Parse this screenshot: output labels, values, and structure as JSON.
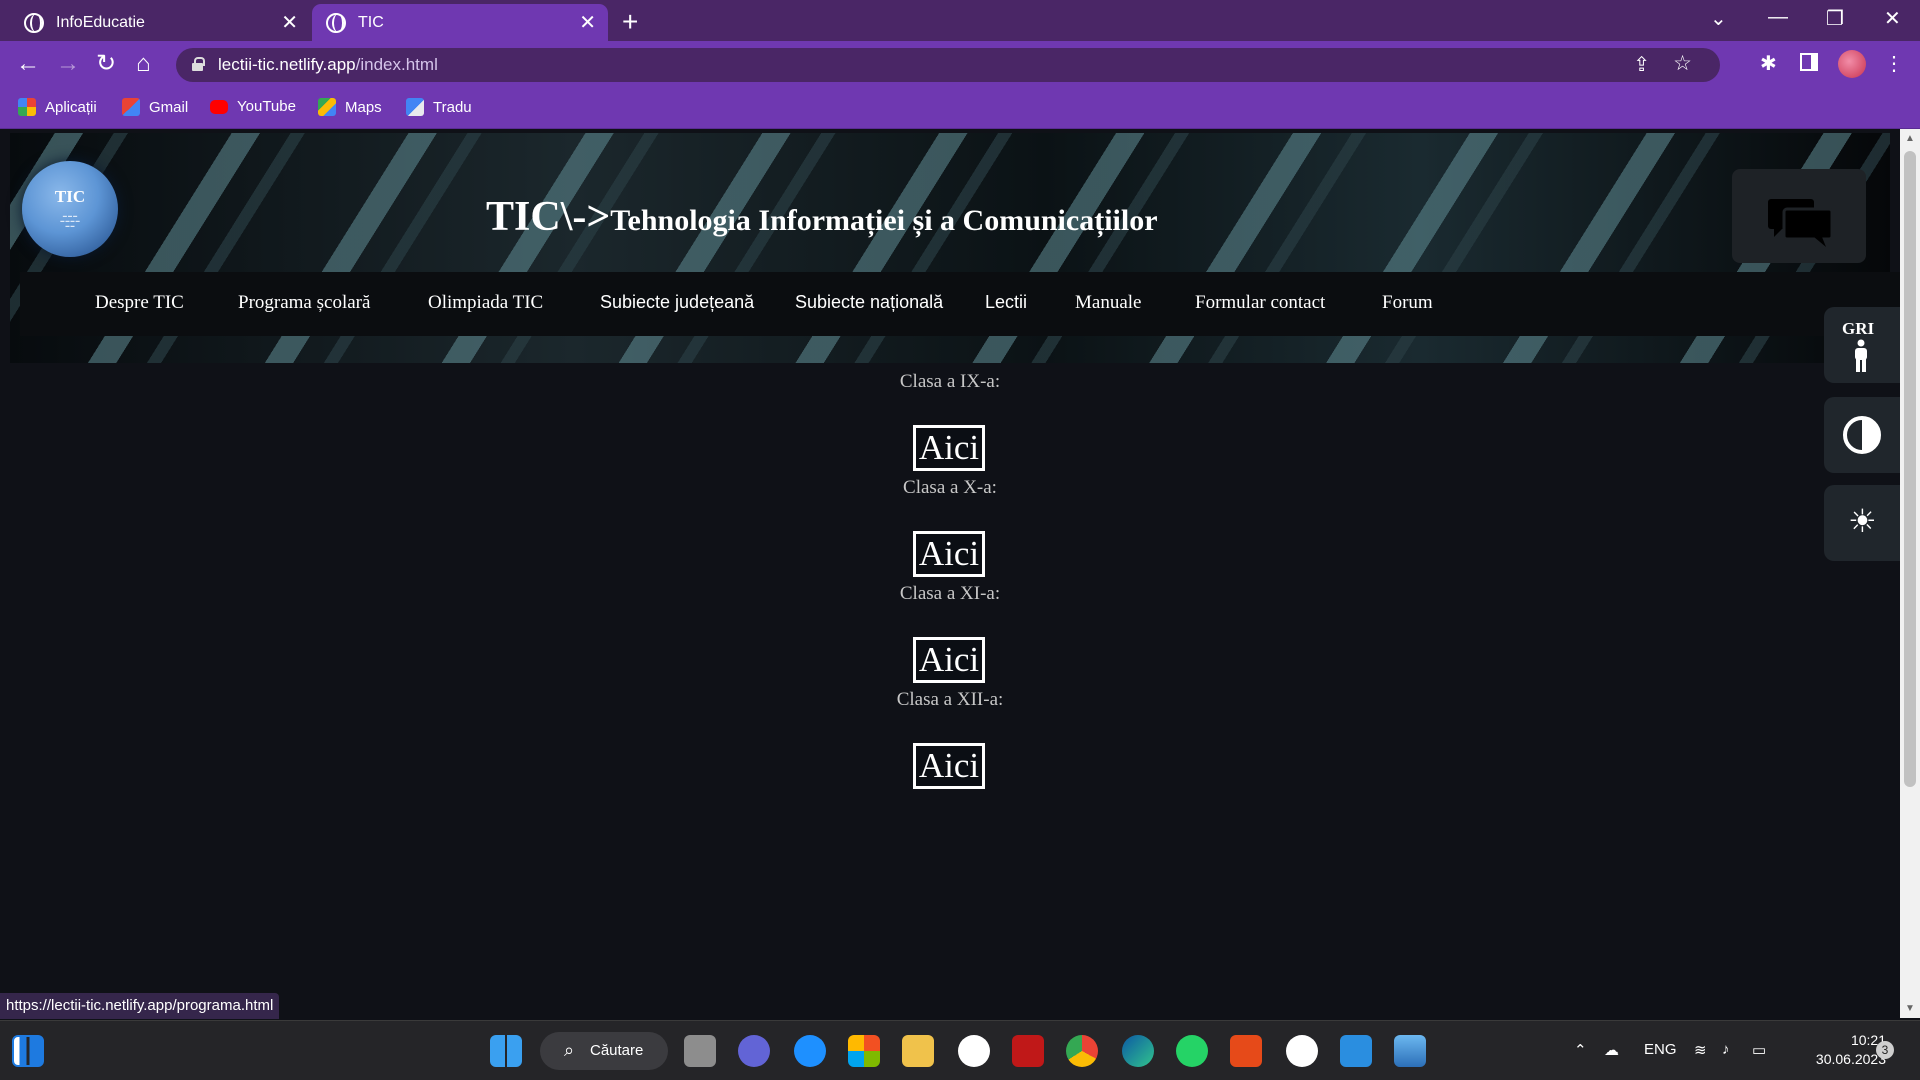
{
  "browser": {
    "tabs": [
      {
        "title": "InfoEducatie",
        "active": false
      },
      {
        "title": "TIC",
        "active": true
      }
    ],
    "url_host": "lectii-tic.netlify.app",
    "url_path": "/index.html",
    "bookmarks": [
      {
        "label": "Aplicații",
        "icon": "apps-grid-icon"
      },
      {
        "label": "Gmail",
        "icon": "gmail-icon"
      },
      {
        "label": "YouTube",
        "icon": "youtube-icon"
      },
      {
        "label": "Maps",
        "icon": "maps-icon"
      },
      {
        "label": "Tradu",
        "icon": "translate-icon"
      }
    ],
    "status_url": "https://lectii-tic.netlify.app/programa.html"
  },
  "site": {
    "logo_text": "TIC",
    "title_main": "TIC\\->",
    "title_rest": "Tehnologia Informației și a Comunicațiilor",
    "menu": [
      "Despre TIC",
      "Programa școlară",
      "Olimpiada TIC",
      "Subiecte județeană",
      "Subiecte națională",
      "Lectii",
      "Manuale",
      "Formular contact",
      "Forum"
    ],
    "classes": [
      {
        "label": "Clasa a IX-a:",
        "button": "Aici"
      },
      {
        "label": "Clasa a X-a:",
        "button": "Aici"
      },
      {
        "label": "Clasa a XI-a:",
        "button": "Aici"
      },
      {
        "label": "Clasa a XII-a:",
        "button": "Aici"
      }
    ],
    "accessibility": {
      "gri_label": "GRI"
    }
  },
  "taskbar": {
    "search_label": "Căutare",
    "language": "ENG",
    "time": "10:21",
    "date": "30.06.2023",
    "notification_count": "3"
  },
  "colors": {
    "tabbar": "#4a2666",
    "chrome_accent": "#6f38b1",
    "page_background": "#0f1117"
  }
}
